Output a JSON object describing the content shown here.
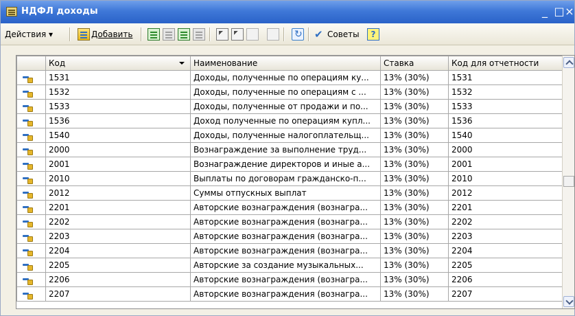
{
  "window": {
    "title": "НДФЛ доходы",
    "minimize_label": "_",
    "maximize_label": "□",
    "close_label": "×"
  },
  "toolbar": {
    "actions_label": "Действия ▾",
    "add_label": "Добавить",
    "tips_label": "Советы",
    "help_label": "?"
  },
  "table": {
    "columns": [
      {
        "label": "Код"
      },
      {
        "label": "Наименование"
      },
      {
        "label": "Ставка"
      },
      {
        "label": "Код для отчетности"
      }
    ],
    "rows": [
      {
        "code": "1531",
        "name": "Доходы, полученные по операциям ку...",
        "rate": "13% (30%)",
        "report_code": "1531"
      },
      {
        "code": "1532",
        "name": "Доходы, полученные по операциям с ...",
        "rate": "13% (30%)",
        "report_code": "1532"
      },
      {
        "code": "1533",
        "name": "Доходы, полученные от продажи и по...",
        "rate": "13% (30%)",
        "report_code": "1533"
      },
      {
        "code": "1536",
        "name": "Доход полученные по операциям купл...",
        "rate": "13% (30%)",
        "report_code": "1536"
      },
      {
        "code": "1540",
        "name": "Доходы, полученные налогоплательщ...",
        "rate": "13% (30%)",
        "report_code": "1540"
      },
      {
        "code": "2000",
        "name": "Вознаграждение за выполнение труд...",
        "rate": "13% (30%)",
        "report_code": "2000"
      },
      {
        "code": "2001",
        "name": "Вознаграждение директоров и иные а...",
        "rate": "13% (30%)",
        "report_code": "2001"
      },
      {
        "code": "2010",
        "name": "Выплаты по договорам гражданско-п...",
        "rate": "13% (30%)",
        "report_code": "2010"
      },
      {
        "code": "2012",
        "name": "Суммы отпускных выплат",
        "rate": "13% (30%)",
        "report_code": "2012"
      },
      {
        "code": "2201",
        "name": "Авторские вознаграждения (вознагра...",
        "rate": "13% (30%)",
        "report_code": "2201"
      },
      {
        "code": "2202",
        "name": "Авторские вознаграждения (вознагра...",
        "rate": "13% (30%)",
        "report_code": "2202"
      },
      {
        "code": "2203",
        "name": "Авторские вознаграждения (вознагра...",
        "rate": "13% (30%)",
        "report_code": "2203"
      },
      {
        "code": "2204",
        "name": "Авторские вознаграждения (вознагра...",
        "rate": "13% (30%)",
        "report_code": "2204"
      },
      {
        "code": "2205",
        "name": "Авторские за создание музыкальных...",
        "rate": "13% (30%)",
        "report_code": "2205"
      },
      {
        "code": "2206",
        "name": "Авторские вознаграждения (вознагра...",
        "rate": "13% (30%)",
        "report_code": "2206"
      },
      {
        "code": "2207",
        "name": "Авторские вознаграждения (вознагра...",
        "rate": "13% (30%)",
        "report_code": "2207"
      }
    ]
  },
  "colors": {
    "title_bar": "#2a62c8",
    "window_bg": "#f3f0e5",
    "row_icon": "#e5b62b"
  }
}
